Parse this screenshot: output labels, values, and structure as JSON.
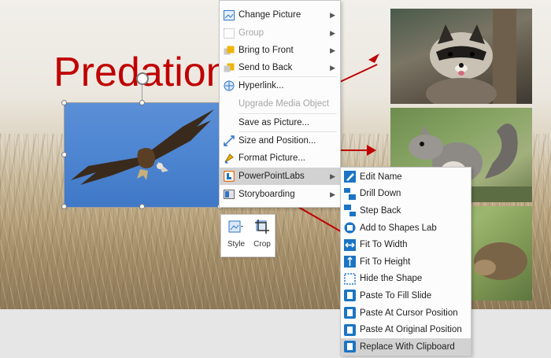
{
  "slide": {
    "title": "Predation"
  },
  "context_menu": {
    "items": [
      {
        "label": "Change Picture",
        "icon": "change-picture-icon",
        "submenu": true,
        "disabled": false
      },
      {
        "label": "Group",
        "icon": "group-icon",
        "submenu": true,
        "disabled": true
      },
      {
        "label": "Bring to Front",
        "icon": "bring-to-front-icon",
        "submenu": true,
        "disabled": false
      },
      {
        "label": "Send to Back",
        "icon": "send-to-back-icon",
        "submenu": true,
        "disabled": false
      },
      {
        "label": "Hyperlink...",
        "icon": "hyperlink-icon",
        "submenu": false,
        "disabled": false
      },
      {
        "label": "Upgrade Media Object",
        "icon": "",
        "submenu": false,
        "disabled": true
      },
      {
        "label": "Save as Picture...",
        "icon": "",
        "submenu": false,
        "disabled": false
      },
      {
        "label": "Size and Position...",
        "icon": "size-position-icon",
        "submenu": false,
        "disabled": false
      },
      {
        "label": "Format Picture...",
        "icon": "format-picture-icon",
        "submenu": false,
        "disabled": false
      },
      {
        "label": "PowerPointLabs",
        "icon": "powerpointlabs-icon",
        "submenu": true,
        "disabled": false
      },
      {
        "label": "Storyboarding",
        "icon": "storyboarding-icon",
        "submenu": true,
        "disabled": false
      }
    ]
  },
  "mini_toolbar": {
    "style_label": "Style",
    "crop_label": "Crop"
  },
  "submenu": {
    "items": [
      {
        "label": "Edit Name",
        "icon": "edit-name-icon"
      },
      {
        "label": "Drill Down",
        "icon": "drill-down-icon"
      },
      {
        "label": "Step Back",
        "icon": "step-back-icon"
      },
      {
        "label": "Add to Shapes Lab",
        "icon": "shapes-lab-icon"
      },
      {
        "label": "Fit To Width",
        "icon": "fit-width-icon"
      },
      {
        "label": "Fit To Height",
        "icon": "fit-height-icon"
      },
      {
        "label": "Hide the Shape",
        "icon": "hide-shape-icon"
      },
      {
        "label": "Paste To Fill Slide",
        "icon": "paste-icon"
      },
      {
        "label": "Paste At Cursor Position",
        "icon": "paste-icon"
      },
      {
        "label": "Paste At Original Position",
        "icon": "paste-icon"
      },
      {
        "label": "Replace With Clipboard",
        "icon": "paste-icon"
      }
    ]
  },
  "colors": {
    "title": "#c00000",
    "accent": "#1b74c4",
    "highlight": "#d2d2d2"
  }
}
